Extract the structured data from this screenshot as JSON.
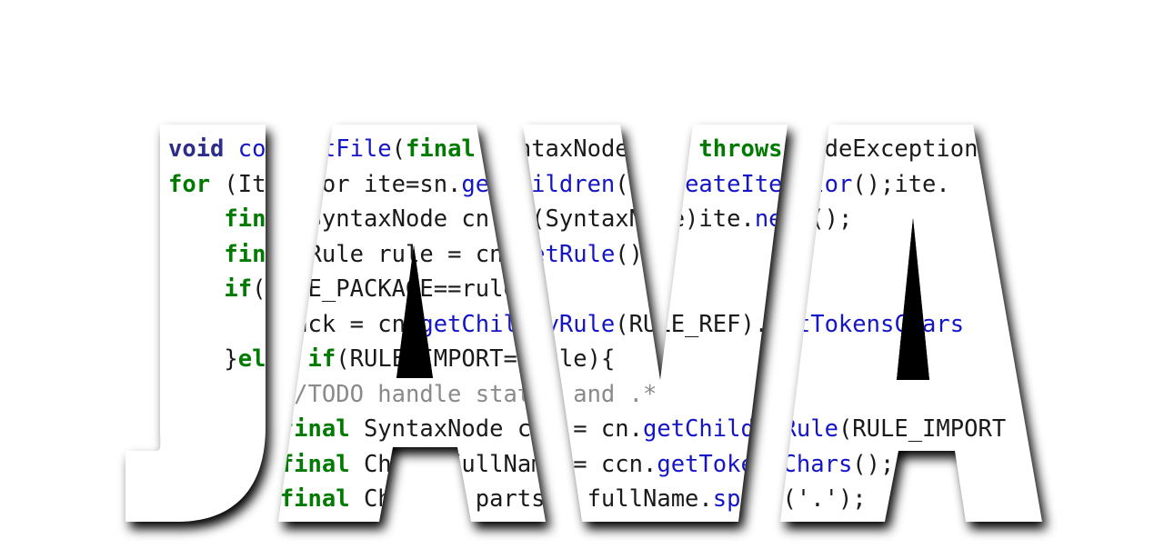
{
  "word": "JAVA",
  "colors": {
    "background": "#ffffff",
    "letter_fill": "#ffffff",
    "letter_shadow": "#000000",
    "keyword_primary": "#2d2d8a",
    "keyword_secondary": "#007a00",
    "method": "#1515c8",
    "comment": "#8a8a8a",
    "text": "#1a1a1a"
  },
  "code_lines": [
    {
      "tokens": [
        {
          "t": "void ",
          "c": "kw1"
        },
        {
          "t": "convertFile",
          "c": "fn"
        },
        {
          "t": "(",
          "c": "tx"
        },
        {
          "t": "final",
          "c": "kw2"
        },
        {
          "t": " SyntaxNode sn) ",
          "c": "tx"
        },
        {
          "t": "throws",
          "c": "kw2"
        },
        {
          "t": " CodeException{",
          "c": "tx"
        }
      ]
    },
    {
      "tokens": [
        {
          "t": "for",
          "c": "kw2"
        },
        {
          "t": " (Iterator ite=sn.",
          "c": "tx"
        },
        {
          "t": "getChildren",
          "c": "fn"
        },
        {
          "t": "().",
          "c": "tx"
        },
        {
          "t": "createIterator",
          "c": "fn"
        },
        {
          "t": "();ite.",
          "c": "tx"
        }
      ]
    },
    {
      "tokens": [
        {
          "t": "    ",
          "c": "tx"
        },
        {
          "t": "final",
          "c": "kw2"
        },
        {
          "t": " SyntaxNode cn = (SyntaxNode)ite.",
          "c": "tx"
        },
        {
          "t": "next",
          "c": "fn"
        },
        {
          "t": "();",
          "c": "tx"
        }
      ]
    },
    {
      "tokens": [
        {
          "t": "    ",
          "c": "tx"
        },
        {
          "t": "final",
          "c": "kw2"
        },
        {
          "t": " Rule rule = cn.",
          "c": "tx"
        },
        {
          "t": "getRule",
          "c": "fn"
        },
        {
          "t": "();",
          "c": "tx"
        }
      ]
    },
    {
      "tokens": [
        {
          "t": "    ",
          "c": "tx"
        },
        {
          "t": "if",
          "c": "kw2"
        },
        {
          "t": "(RULE_PACKAGE==rule){",
          "c": "tx"
        }
      ]
    },
    {
      "tokens": [
        {
          "t": "        pack = cn.",
          "c": "tx"
        },
        {
          "t": "getChildByRule",
          "c": "fn"
        },
        {
          "t": "(RULE_REF).",
          "c": "tx"
        },
        {
          "t": "getTokensChars",
          "c": "fn"
        }
      ]
    },
    {
      "tokens": [
        {
          "t": "    }",
          "c": "tx"
        },
        {
          "t": "else",
          "c": "kw2"
        },
        {
          "t": " ",
          "c": "tx"
        },
        {
          "t": "if",
          "c": "kw2"
        },
        {
          "t": "(RULE_IMPORT==rule){",
          "c": "tx"
        }
      ]
    },
    {
      "tokens": [
        {
          "t": "        //TODO handle static and .*",
          "c": "cm"
        }
      ]
    },
    {
      "tokens": [
        {
          "t": "        ",
          "c": "tx"
        },
        {
          "t": "final",
          "c": "kw2"
        },
        {
          "t": " SyntaxNode ccn = cn.",
          "c": "tx"
        },
        {
          "t": "getChildByRule",
          "c": "fn"
        },
        {
          "t": "(RULE_IMPORT",
          "c": "tx"
        }
      ]
    },
    {
      "tokens": [
        {
          "t": "        ",
          "c": "tx"
        },
        {
          "t": "final",
          "c": "kw2"
        },
        {
          "t": " Chars fullName = ccn.",
          "c": "tx"
        },
        {
          "t": "getTokensChars",
          "c": "fn"
        },
        {
          "t": "();",
          "c": "tx"
        }
      ]
    },
    {
      "tokens": [
        {
          "t": "        ",
          "c": "tx"
        },
        {
          "t": "final",
          "c": "kw2"
        },
        {
          "t": " Chars[] parts = fullName.",
          "c": "tx"
        },
        {
          "t": "split",
          "c": "fn"
        },
        {
          "t": "('.');",
          "c": "tx"
        }
      ]
    }
  ]
}
